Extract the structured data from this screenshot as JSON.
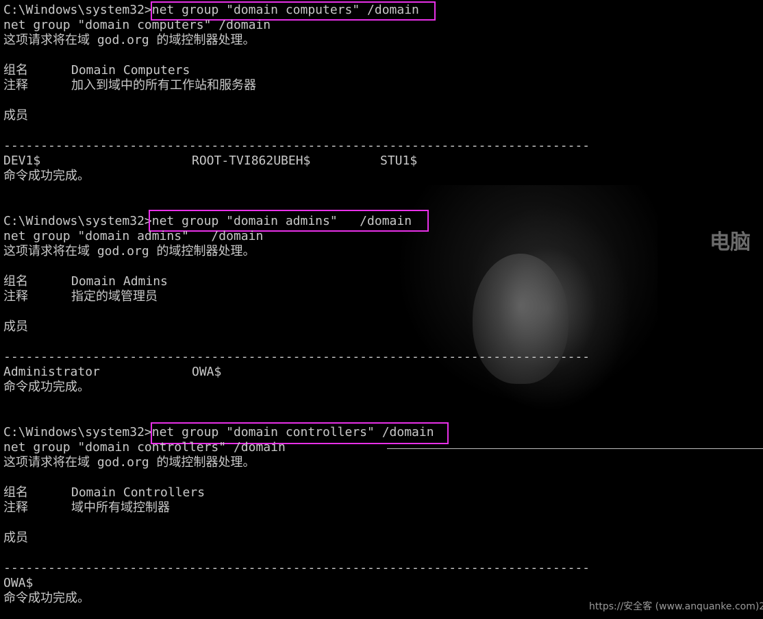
{
  "terminal": {
    "prompt": "C:\\Windows\\system32>",
    "sections": [
      {
        "command": "net group \"domain computers\" /domain",
        "echo": "net group \"domain computers\" /domain",
        "request_line": "这项请求将在域 god.org 的域控制器处理。",
        "group_label": "组名",
        "group_value": "Domain Computers",
        "comment_label": "注释",
        "comment_value": "加入到域中的所有工作站和服务器",
        "members_label": "成员",
        "separator": "-------------------------------------------------------------------------------",
        "members": [
          "DEV1$",
          "ROOT-TVI862UBEH$",
          "STU1$"
        ],
        "done": "命令成功完成。"
      },
      {
        "command": "net group \"domain admins\"   /domain",
        "echo": "net group \"domain admins\"   /domain",
        "request_line": "这项请求将在域 god.org 的域控制器处理。",
        "group_label": "组名",
        "group_value": "Domain Admins",
        "comment_label": "注释",
        "comment_value": "指定的域管理员",
        "members_label": "成员",
        "separator": "-------------------------------------------------------------------------------",
        "members": [
          "Administrator",
          "OWA$"
        ],
        "done": "命令成功完成。"
      },
      {
        "command": "net group \"domain controllers\" /domain",
        "echo": "net group \"domain controllers\" /domain",
        "request_line": "这项请求将在域 god.org 的域控制器处理。",
        "group_label": "组名",
        "group_value": "Domain Controllers",
        "comment_label": "注释",
        "comment_value": "域中所有域控制器",
        "members_label": "成员",
        "separator": "-------------------------------------------------------------------------------",
        "members": [
          "OWA$"
        ],
        "done": "命令成功完成。"
      }
    ]
  },
  "background": {
    "watermark_text": "电脑",
    "footer_watermark": "https://安全客 (www.anquanke.com)2"
  },
  "colors": {
    "background": "#000000",
    "text": "#c9c9c9",
    "highlight_box": "#e830e8"
  }
}
